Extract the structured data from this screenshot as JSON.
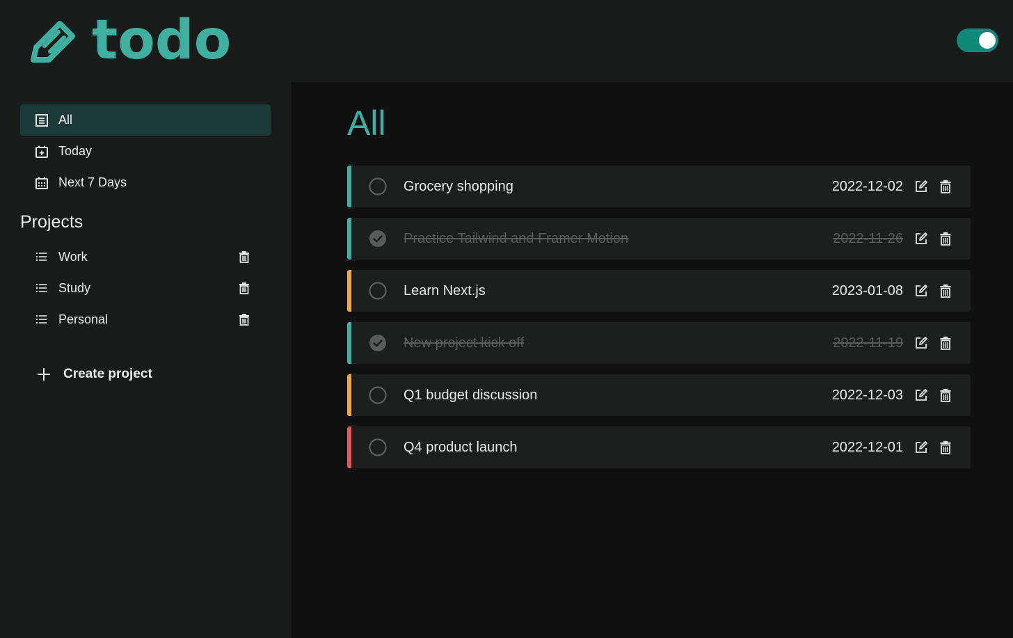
{
  "app": {
    "logo_text": "todo",
    "theme_toggle": "on"
  },
  "colors": {
    "accent": "#3fb0a0",
    "toggle": "#0f8a78",
    "priority_low": "#3fb0a0",
    "priority_medium": "#f0a840",
    "priority_high": "#e05a5a"
  },
  "sidebar": {
    "nav": [
      {
        "label": "All",
        "icon": "list-box-icon",
        "active": true
      },
      {
        "label": "Today",
        "icon": "calendar-plus-icon",
        "active": false
      },
      {
        "label": "Next 7 Days",
        "icon": "calendar-grid-icon",
        "active": false
      }
    ],
    "projects_title": "Projects",
    "projects": [
      {
        "label": "Work"
      },
      {
        "label": "Study"
      },
      {
        "label": "Personal"
      }
    ],
    "create_project_label": "Create project"
  },
  "main": {
    "title": "All",
    "tasks": [
      {
        "title": "Grocery shopping",
        "date": "2022-12-02",
        "done": false,
        "priority": "low"
      },
      {
        "title": "Practice Tailwind and Framer Motion",
        "date": "2022-11-26",
        "done": true,
        "priority": "low"
      },
      {
        "title": "Learn Next.js",
        "date": "2023-01-08",
        "done": false,
        "priority": "medium"
      },
      {
        "title": "New project kick off",
        "date": "2022-11-19",
        "done": true,
        "priority": "low"
      },
      {
        "title": "Q1 budget discussion",
        "date": "2022-12-03",
        "done": false,
        "priority": "medium"
      },
      {
        "title": "Q4 product launch",
        "date": "2022-12-01",
        "done": false,
        "priority": "high"
      }
    ]
  }
}
